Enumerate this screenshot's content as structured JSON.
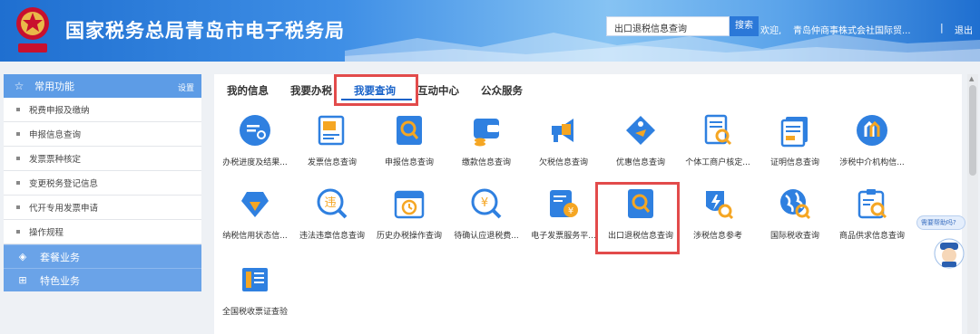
{
  "header": {
    "title": "国家税务总局青岛市电子税务局",
    "search_value": "出口退税信息查询",
    "search_button": "搜索",
    "welcome": "欢迎,",
    "company": "青岛仲商事株式会社国际贸...",
    "separator": "|",
    "logout": "退出"
  },
  "sidebar": {
    "common_title": "常用功能",
    "settings": "设置",
    "items": [
      {
        "label": "税费申报及缴纳"
      },
      {
        "label": "申报信息查询"
      },
      {
        "label": "发票票种核定"
      },
      {
        "label": "变更税务登记信息"
      },
      {
        "label": "代开专用发票申请"
      },
      {
        "label": "操作规程"
      }
    ],
    "sections": [
      {
        "label": "套餐业务",
        "icon": "layers-icon"
      },
      {
        "label": "特色业务",
        "icon": "grid-icon"
      }
    ]
  },
  "tabs": [
    {
      "label": "我的信息"
    },
    {
      "label": "我要办税"
    },
    {
      "label": "我要查询"
    },
    {
      "label": "互动中心"
    },
    {
      "label": "公众服务"
    }
  ],
  "active_tab": "我要查询",
  "grid": [
    {
      "label": "办税进度及结果...",
      "icon": "progress-icon"
    },
    {
      "label": "发票信息查询",
      "icon": "invoice-icon"
    },
    {
      "label": "申报信息查询",
      "icon": "search-doc-icon"
    },
    {
      "label": "缴款信息查询",
      "icon": "wallet-icon"
    },
    {
      "label": "欠税信息查询",
      "icon": "megaphone-icon"
    },
    {
      "label": "优惠信息查询",
      "icon": "tag-icon"
    },
    {
      "label": "个体工商户核定...",
      "icon": "doc-search-icon"
    },
    {
      "label": "证明信息查询",
      "icon": "certificate-icon"
    },
    {
      "label": "涉税中介机构信...",
      "icon": "agency-icon"
    },
    {
      "label": "纳税信用状态信...",
      "icon": "diamond-icon"
    },
    {
      "label": "违法违章信息查询",
      "icon": "violation-icon"
    },
    {
      "label": "历史办税操作查询",
      "icon": "history-icon"
    },
    {
      "label": "待确认应退税费...",
      "icon": "refund-icon"
    },
    {
      "label": "电子发票服务平...",
      "icon": "e-invoice-icon"
    },
    {
      "label": "出口退税信息查询",
      "icon": "export-refund-icon"
    },
    {
      "label": "涉税信息参考",
      "icon": "reference-icon"
    },
    {
      "label": "国际税收查询",
      "icon": "globe-icon"
    },
    {
      "label": "商品供求信息查询",
      "icon": "goods-icon"
    },
    {
      "label": "全国税收票证查验",
      "icon": "tax-voucher-icon"
    }
  ],
  "help_bubble": "需要帮助吗?",
  "colors": {
    "primary": "#1a63c9",
    "sidebar_header": "#5d9ce6",
    "highlight": "#e24b4b",
    "icon_blue": "#2f80e0",
    "icon_orange": "#f5a623"
  }
}
